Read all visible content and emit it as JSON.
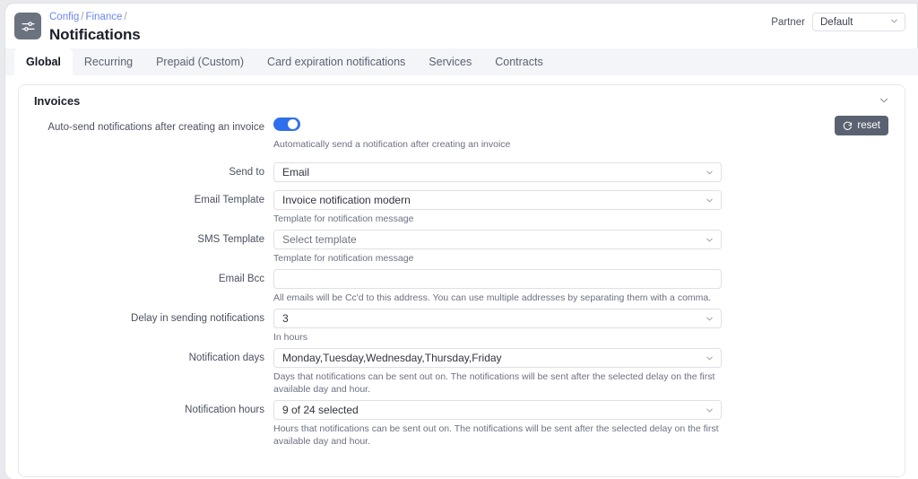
{
  "header": {
    "icon": "sliders-icon",
    "breadcrumb": [
      {
        "label": "Config",
        "link": true
      },
      {
        "label": "Finance",
        "link": true
      }
    ],
    "breadcrumb_separator": "/",
    "title": "Notifications",
    "partner_label": "Partner",
    "partner_value": "Default"
  },
  "tabs": [
    {
      "label": "Global",
      "active": true
    },
    {
      "label": "Recurring",
      "active": false
    },
    {
      "label": "Prepaid (Custom)",
      "active": false
    },
    {
      "label": "Card expiration notifications",
      "active": false
    },
    {
      "label": "Services",
      "active": false
    },
    {
      "label": "Contracts",
      "active": false
    }
  ],
  "panel": {
    "title": "Invoices",
    "collapse_icon": "chevron-down-icon"
  },
  "form": {
    "autosend": {
      "label": "Auto-send notifications after creating an invoice",
      "toggle_on": true,
      "help": "Automatically send a notification after creating an invoice"
    },
    "reset_button": {
      "label": "reset",
      "icon": "refresh-icon"
    },
    "send_to": {
      "label": "Send to",
      "value": "Email",
      "placeholder": "",
      "help": ""
    },
    "email_template": {
      "label": "Email Template",
      "value": "Invoice notification modern",
      "help": "Template for notification message"
    },
    "sms_template": {
      "label": "SMS Template",
      "value": "Select template",
      "is_placeholder": true,
      "help": "Template for notification message"
    },
    "email_bcc": {
      "label": "Email Bcc",
      "value": "",
      "placeholder": "",
      "help": "All emails will be Cc'd to this address. You can use multiple addresses by separating them with a comma."
    },
    "delay": {
      "label": "Delay in sending notifications",
      "value": "3",
      "help": "In hours"
    },
    "notification_days": {
      "label": "Notification days",
      "value": "Monday,Tuesday,Wednesday,Thursday,Friday",
      "help": "Days that notifications can be sent out on. The notifications will be sent after the selected delay on the first available day and hour."
    },
    "notification_hours": {
      "label": "Notification hours",
      "value": "9 of 24 selected",
      "help": "Hours that notifications can be sent out on. The notifications will be sent after the selected delay on the first available day and hour."
    }
  },
  "colors": {
    "accent_blue": "#2f6fed",
    "link_blue": "#6b86f0",
    "reset_button": "#5a6271",
    "header_icon": "#6b7280"
  }
}
